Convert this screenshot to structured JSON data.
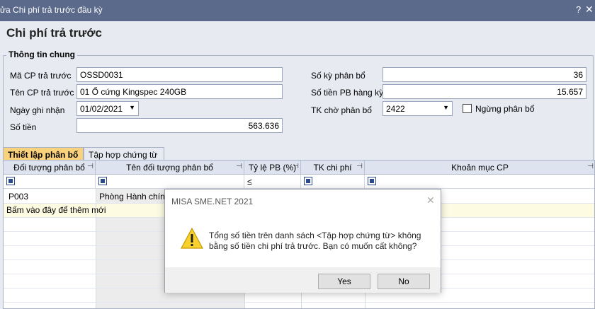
{
  "window": {
    "title": "ửa Chi phí trả trước đầu kỳ",
    "help": "?",
    "close": "✕"
  },
  "form": {
    "heading": "Chi phí trả trước",
    "group_title": "Thông tin chung",
    "fields": {
      "ma_cp": {
        "label": "Mã CP trả trước",
        "value": "OSSD0031"
      },
      "ten_cp": {
        "label": "Tên CP trả trước",
        "value": "01 Ổ cứng Kingspec 240GB"
      },
      "ngay": {
        "label": "Ngày ghi nhận",
        "value": "01/02/2021"
      },
      "so_tien": {
        "label": "Số tiền",
        "value": "563.636"
      },
      "so_ky": {
        "label": "Số kỳ phân bổ",
        "value": "36"
      },
      "so_tien_pb": {
        "label": "Số tiền PB hàng kỳ",
        "value": "15.657"
      },
      "tk_cho": {
        "label": "TK chờ phân bổ",
        "value": "2422"
      },
      "ngung": {
        "label": "Ngừng phân bổ",
        "checked": false
      }
    }
  },
  "tabs": [
    {
      "label": "Thiết lập phân bổ",
      "active": true
    },
    {
      "label": "Tập hợp chứng từ",
      "active": false
    }
  ],
  "grid": {
    "columns": [
      "Đối tượng phân bổ",
      "Tên đối tượng phân bổ",
      "Tỷ lệ PB (%)",
      "TK chi phí",
      "Khoản mục CP"
    ],
    "filter_ratio": "≤",
    "rows": [
      {
        "code": "P003",
        "name": "Phòng Hành chính"
      }
    ],
    "add_row": "Bấm vào đây để thêm mới"
  },
  "dialog": {
    "title": "MISA SME.NET 2021",
    "message_line1": "Tổng số tiền trên danh sách <Tập hợp chứng từ> không",
    "message_line2": "bằng số tiền chi phí trả trước. Bạn có muốn cất không?",
    "yes": "Yes",
    "no": "No"
  }
}
